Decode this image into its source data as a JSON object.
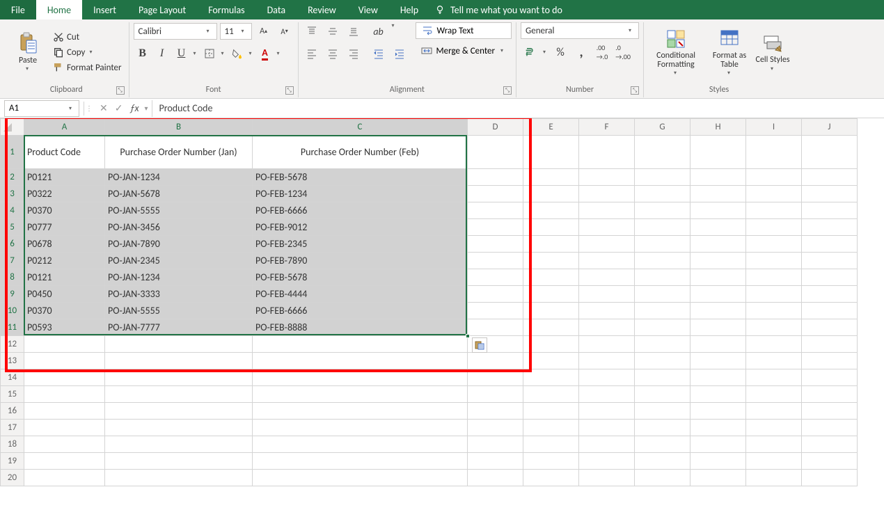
{
  "menu": {
    "file": "File",
    "home": "Home",
    "insert": "Insert",
    "pageLayout": "Page Layout",
    "formulas": "Formulas",
    "data": "Data",
    "review": "Review",
    "view": "View",
    "help": "Help",
    "tell": "Tell me what you want to do"
  },
  "ribbon": {
    "paste": "Paste",
    "cut": "Cut",
    "copy": "Copy",
    "formatPainter": "Format Painter",
    "clipboard": "Clipboard",
    "font": "Calibri",
    "fontSize": "11",
    "fontGroup": "Font",
    "wrap": "Wrap Text",
    "merge": "Merge & Center",
    "alignment": "Alignment",
    "numberFormat": "General",
    "percent": "%",
    "comma": ",",
    "numberGroup": "Number",
    "condFmt": "Conditional Formatting",
    "fmtTable": "Format as Table",
    "cellStyles": "Cell Styles",
    "styles": "Styles"
  },
  "nameBox": "A1",
  "formulaBar": "Product Code",
  "columns": [
    "A",
    "B",
    "C",
    "D",
    "E",
    "F",
    "G",
    "H",
    "I",
    "J"
  ],
  "headers": {
    "A": "Product Code",
    "B": "Purchase Order Number (Jan)",
    "C": "Purchase Order Number (Feb)"
  },
  "rows": [
    {
      "A": "P0121",
      "B": "PO-JAN-1234",
      "C": "PO-FEB-5678"
    },
    {
      "A": "P0322",
      "B": "PO-JAN-5678",
      "C": "PO-FEB-1234"
    },
    {
      "A": "P0370",
      "B": "PO-JAN-5555",
      "C": "PO-FEB-6666"
    },
    {
      "A": "P0777",
      "B": "PO-JAN-3456",
      "C": "PO-FEB-9012"
    },
    {
      "A": "P0678",
      "B": "PO-JAN-7890",
      "C": "PO-FEB-2345"
    },
    {
      "A": "P0212",
      "B": "PO-JAN-2345",
      "C": "PO-FEB-7890"
    },
    {
      "A": "P0121",
      "B": "PO-JAN-1234",
      "C": "PO-FEB-5678"
    },
    {
      "A": "P0450",
      "B": "PO-JAN-3333",
      "C": "PO-FEB-4444"
    },
    {
      "A": "P0370",
      "B": "PO-JAN-5555",
      "C": "PO-FEB-6666"
    },
    {
      "A": "P0593",
      "B": "PO-JAN-7777",
      "C": "PO-FEB-8888"
    }
  ],
  "emptyRows": [
    12,
    13,
    14,
    15,
    16,
    17,
    18,
    19,
    20
  ]
}
